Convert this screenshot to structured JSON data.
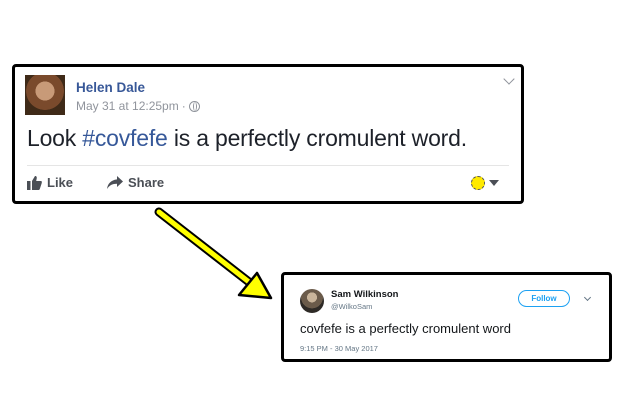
{
  "facebook_post": {
    "author": "Helen Dale",
    "timestamp": "May 31 at 12:25pm",
    "separator": "·",
    "text_before": "Look ",
    "hashtag": "#covfefe",
    "text_after": " is a perfectly cromulent word.",
    "actions": {
      "like_label": "Like",
      "share_label": "Share"
    },
    "icons": {
      "audience": "globe-icon",
      "options": "chevron-down-icon",
      "like": "thumbs-up-icon",
      "share": "share-arrow-icon",
      "reaction": "reaction-icon"
    },
    "colors": {
      "name_link": "#385898",
      "hashtag": "#365899",
      "reaction_yellow": "#ffea00"
    }
  },
  "connector_arrow": {
    "color": "#ffff00",
    "outline": "#000000"
  },
  "tweet": {
    "author": "Sam Wilkinson",
    "handle": "@WilkoSam",
    "follow_label": "Follow",
    "text": "covfefe is a perfectly cromulent word",
    "timestamp": "9:15 PM - 30 May 2017",
    "colors": {
      "follow_blue": "#1da1f2"
    }
  }
}
